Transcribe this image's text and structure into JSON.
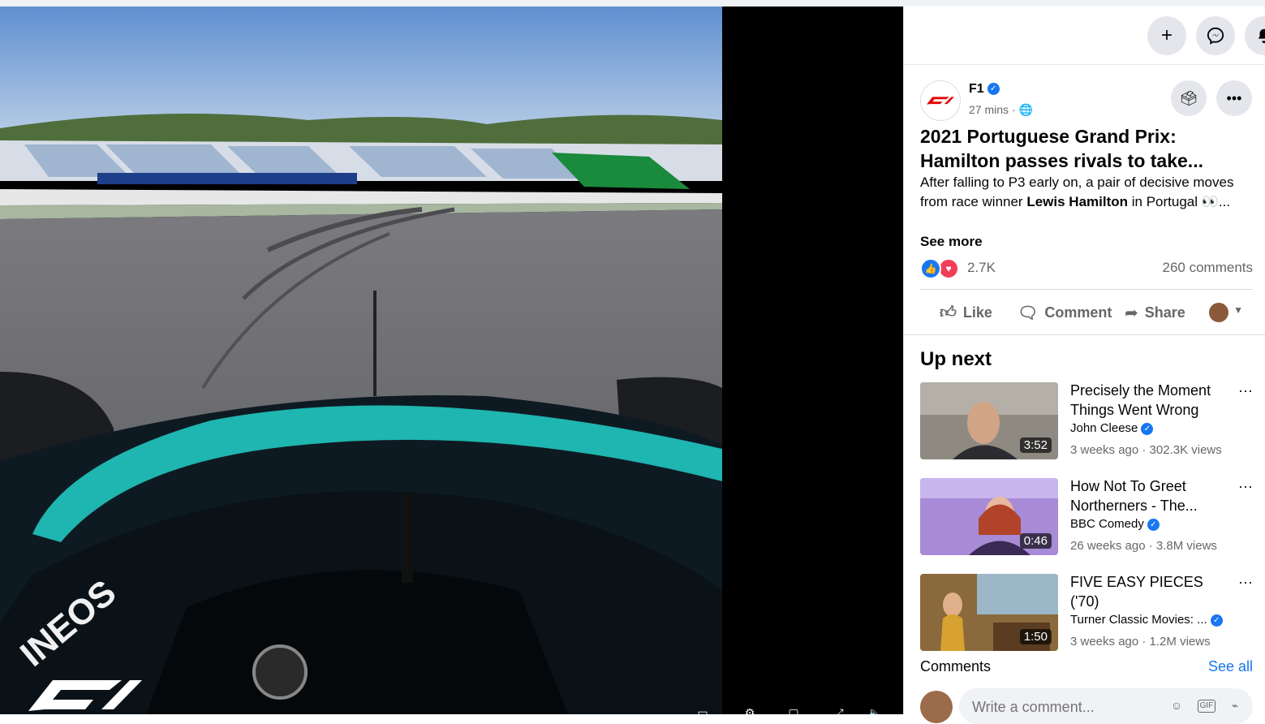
{
  "header": {
    "add_icon": "+",
    "messenger_icon": "messenger-icon",
    "notifications_icon": "bell-icon"
  },
  "post": {
    "page_name": "F1",
    "time": "27 mins",
    "meta_sep": " · ",
    "globe_icon": "🌐",
    "title": "2021 Portuguese Grand Prix: Hamilton passes rivals to take...",
    "body_before": "After falling to P3 early on, a pair of decisive moves from race winner ",
    "body_bold": "Lewis Hamilton",
    "body_after": " in Portugal 👀...",
    "see_more": "See more",
    "reaction_count": "2.7K",
    "comment_count": "260 comments",
    "actions": {
      "like": "Like",
      "comment": "Comment",
      "share": "Share"
    }
  },
  "up_next": {
    "heading": "Up next",
    "videos": [
      {
        "title": "Precisely the Moment Things Went Wrong",
        "channel": "John Cleese",
        "stats": "3 weeks ago · 302.3K views",
        "duration": "3:52"
      },
      {
        "title": "How Not To Greet Northerners - The...",
        "channel": "BBC Comedy",
        "stats": "26 weeks ago · 3.8M views",
        "duration": "0:46"
      },
      {
        "title": "FIVE EASY PIECES ('70)",
        "channel": "Turner Classic Movies: ...",
        "stats": "3 weeks ago · 1.2M views",
        "duration": "1:50"
      }
    ]
  },
  "comments": {
    "heading": "Comments",
    "see_all": "See all",
    "placeholder": "Write a comment..."
  },
  "colors": {
    "accent": "#1877f2",
    "like_blue": "#1877f2",
    "love_red": "#f33e58",
    "petronas_teal": "#1fb5b0"
  }
}
